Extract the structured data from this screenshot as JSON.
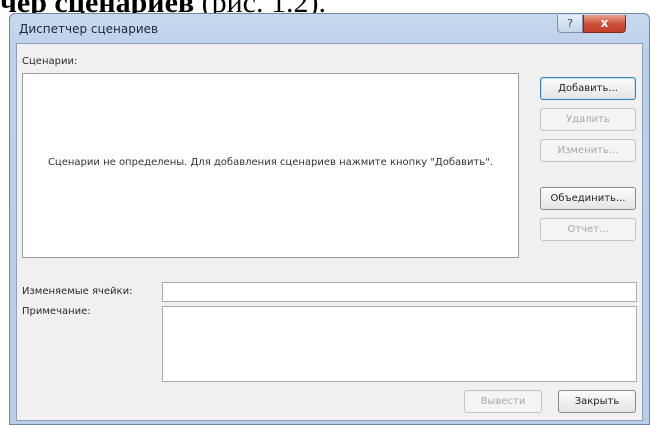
{
  "page": {
    "heading_bold": "чер сценариев",
    "heading_rest": " (рис. 1.2)."
  },
  "window": {
    "title": "Диспетчер сценариев",
    "help_glyph": "?",
    "close_glyph": "x"
  },
  "scenarios": {
    "label": "Сценарии:",
    "empty_text": "Сценарии не определены. Для добавления сценариев нажмите кнопку \"Добавить\"."
  },
  "buttons": {
    "add": "Добавить...",
    "delete": "Удалить",
    "edit": "Изменить...",
    "merge": "Объединить...",
    "report": "Отчет...",
    "show": "Вывести",
    "close": "Закрыть"
  },
  "fields": {
    "changing_cells_label": "Изменяемые ячейки:",
    "changing_cells_value": "",
    "comment_label": "Примечание:",
    "comment_value": ""
  }
}
